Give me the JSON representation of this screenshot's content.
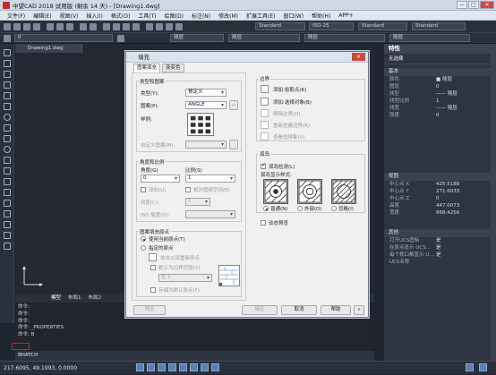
{
  "window": {
    "title": "中望CAD 2018 试用版 (剩余 14 天) - [Drawing1.dwg]",
    "minimize": "—",
    "maximize": "□",
    "close": "✕"
  },
  "menu": [
    "文件(F)",
    "编辑(E)",
    "视图(V)",
    "插入(I)",
    "格式(O)",
    "工具(T)",
    "绘图(D)",
    "标注(N)",
    "修改(M)",
    "扩展工具(E)",
    "窗口(W)",
    "帮助(H)",
    "APP+"
  ],
  "toolbar": {
    "style1": "Standard",
    "dimstyle": "ISO-25",
    "style2": "Standard",
    "style3": "Standard",
    "layer": "0",
    "bylayer1": "随层",
    "bylayer2": "随层",
    "bylayer3": "随层",
    "bylayer4": "随层"
  },
  "doc_tab": "Drawing1.dwg",
  "layout_tabs": [
    "模型",
    "布局1",
    "布局2"
  ],
  "command": {
    "lines": [
      "命令:",
      "命令:",
      "命令:",
      "命令: _PROPERTIES",
      "命令: B"
    ],
    "input": "BHATCH"
  },
  "status": {
    "coords": "217.6095, 49.1993, 0.0000"
  },
  "properties": {
    "title": "特性",
    "selection": "无选择",
    "sections": [
      {
        "name": "基本",
        "rows": [
          [
            "颜色",
            "■ 随层"
          ],
          [
            "图层",
            "0"
          ],
          [
            "线型",
            "—— 随层"
          ],
          [
            "线型比例",
            "1"
          ],
          [
            "线宽",
            "—— 随层"
          ],
          [
            "厚度",
            "0"
          ]
        ]
      },
      {
        "name": "视图",
        "rows": [
          [
            "中心点 X",
            "425.5188"
          ],
          [
            "中心点 Y",
            "271.6033"
          ],
          [
            "中心点 Z",
            "0"
          ],
          [
            "高度",
            "447.0073"
          ],
          [
            "宽度",
            "868.4256"
          ]
        ]
      },
      {
        "name": "其他",
        "rows": [
          [
            "打开UCS图标",
            "是"
          ],
          [
            "在原点显示 UCS...",
            "是"
          ],
          [
            "每个视口都显示 U...",
            "是"
          ],
          [
            "UCS名称",
            ""
          ]
        ]
      }
    ]
  },
  "dialog": {
    "title": "填充",
    "close": "✕",
    "tabs": [
      "图案填充",
      "渐变色"
    ],
    "type_group": "类型和图案",
    "type_label": "类型(Y):",
    "type_value": "预定义",
    "pattern_label": "图案(P):",
    "pattern_value": "ANGLE",
    "browse": "...",
    "sample_label": "样例:",
    "custom_label": "自定义图案(M):",
    "angle_group": "角度和比例",
    "angle_label": "角度(G)",
    "angle_value": "0",
    "scale_label": "比例(S)",
    "scale_value": "1",
    "double_label": "双向(U)",
    "relative_label": "相对图纸空间(E)",
    "spacing_label": "间距(C):",
    "spacing_value": "1",
    "iso_label": "ISO 笔宽(O):",
    "origin_group": "图案填充原点",
    "use_current": "使用当前原点(T)",
    "specified": "指定的原点",
    "click_set": "单击以设置新原点",
    "default_boundary": "默认为边界范围(X)",
    "corner": "左下",
    "store_default": "存储为默认原点(F)",
    "boundary_group": "边界",
    "add_pick": "添加:拾取点(K)",
    "add_select": "添加:选择对象(B)",
    "remove": "删除边界(D)",
    "recreate": "重新创建边界(R)",
    "view_sel": "查看选择集(V)",
    "island_group": "孤岛",
    "island_detect": "孤岛检测(L)",
    "island_style": "孤岛显示样式:",
    "normal": "普通(N)",
    "outer": "外部(O)",
    "ignore": "忽略(I)",
    "preview_live": "动态预览",
    "btn_preview": "预览",
    "btn_ok": "确定",
    "btn_cancel": "取消",
    "btn_help": "帮助",
    "btn_more": "»"
  }
}
